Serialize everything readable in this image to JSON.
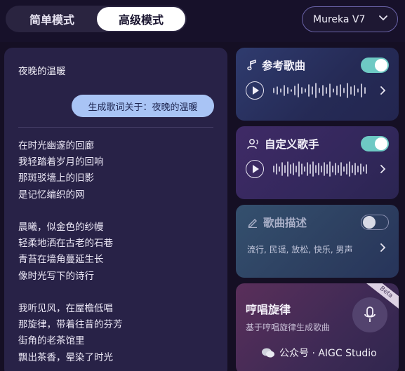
{
  "modes": {
    "simple": "简单模式",
    "advanced": "高级模式"
  },
  "model": {
    "label": "Mureka V7",
    "icon": "chevron-down-icon"
  },
  "lyrics": {
    "title": "夜晚的温暖",
    "prompt": "生成歌词关于：夜晚的温暖",
    "lines": [
      "在时光幽邃的回廊",
      "我轻踏着岁月的回响",
      "那斑驳墙上的旧影",
      "是记忆编织的网",
      "",
      "晨曦，似金色的纱幔",
      "轻柔地洒在古老的石巷",
      "青苔在墙角蔓延生长",
      "像时光写下的诗行",
      "",
      "我听见风，在屋檐低唱",
      "那旋律，带着往昔的芬芳",
      "街角的老茶馆里",
      "飘出茶香，晕染了时光"
    ]
  },
  "cards": {
    "reference": {
      "title": "参考歌曲",
      "icon": "music-note-icon",
      "toggle": true
    },
    "singer": {
      "title": "自定义歌手",
      "icon": "user-voice-icon",
      "toggle": true
    },
    "description": {
      "title": "歌曲描述",
      "icon": "pencil-icon",
      "toggle": false,
      "tags": "流行, 民谣, 放松, 快乐, 男声"
    },
    "humming": {
      "title": "哼唱旋律",
      "subtitle": "基于哼唱旋律生成歌曲",
      "badge": "Beta",
      "icon": "microphone-icon"
    }
  },
  "watermark": "公众号 · AIGC Studio",
  "colors": {
    "background": "#150f24",
    "panel": "#282247",
    "accent_toggle": "#6ec9c4",
    "prompt_chip": "#a9c4f5"
  }
}
